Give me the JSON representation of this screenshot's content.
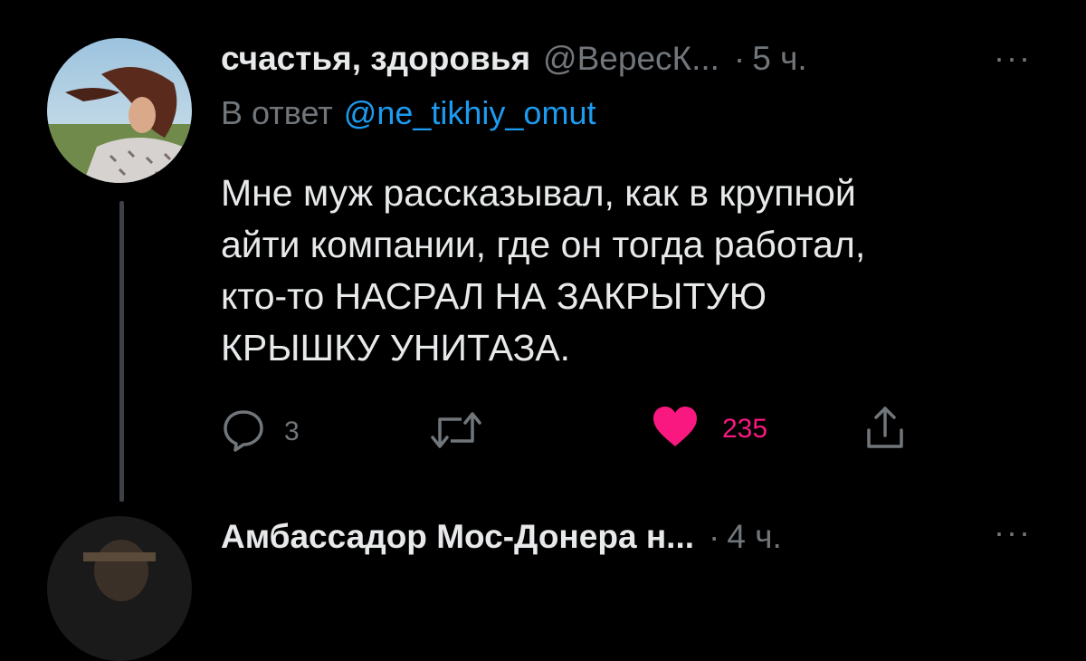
{
  "tweet": {
    "author_name": "счастья, здоровья",
    "author_handle": "@ВересК...",
    "separator": "·",
    "time": "5 ч.",
    "more": "···",
    "reply_prefix": "В ответ",
    "reply_mention": "@ne_tikhiy_omut",
    "body_lines": [
      "Мне муж рассказывал, как в крупной",
      "айти компании, где он тогда работал,",
      "кто-то НАСРАЛ НА ЗАКРЫТУЮ",
      "КРЫШКУ УНИТАЗА."
    ],
    "actions": {
      "reply_count": "3",
      "retweet_count": "",
      "like_count": "235",
      "liked": true,
      "like_color": "#f91880"
    }
  },
  "next_tweet": {
    "author_name": "Амбассадор Мос-Донера н...",
    "separator": "·",
    "time": "4 ч.",
    "more": "···"
  },
  "colors": {
    "background": "#000000",
    "text": "#e7e9ea",
    "muted": "#71767b",
    "link": "#1d9bf0"
  }
}
